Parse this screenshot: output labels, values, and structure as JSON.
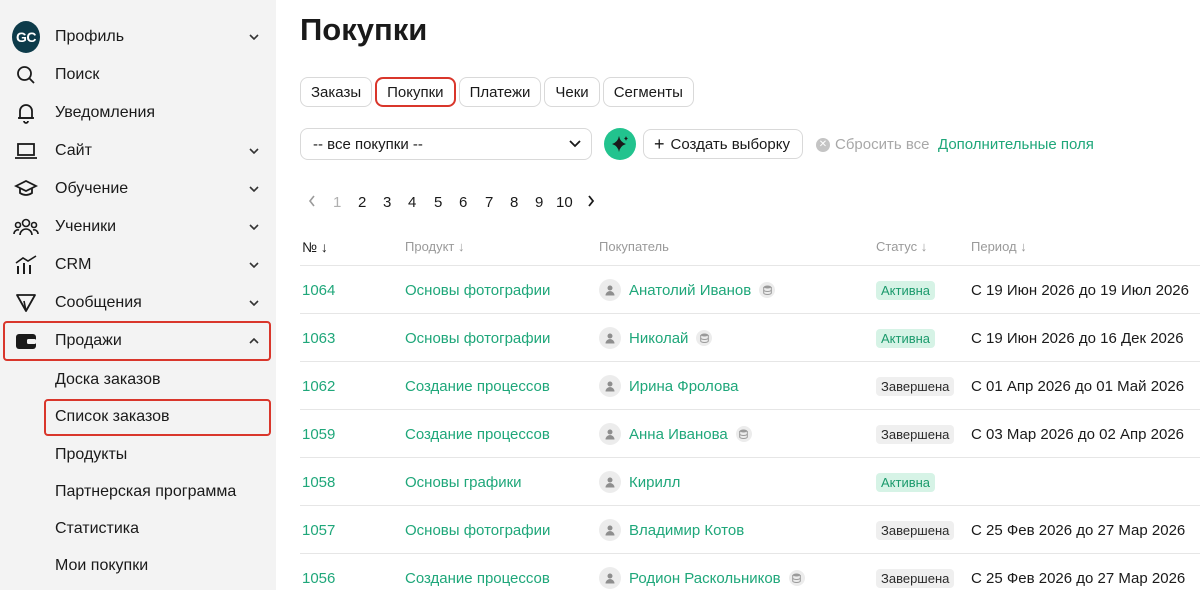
{
  "sidebar": {
    "logo_text": "GC",
    "items": [
      {
        "label": "Профиль",
        "icon": "logo",
        "chevron": "down"
      },
      {
        "label": "Поиск",
        "icon": "search-icon",
        "chevron": ""
      },
      {
        "label": "Уведомления",
        "icon": "bell-icon",
        "chevron": ""
      },
      {
        "label": "Сайт",
        "icon": "laptop-icon",
        "chevron": "down"
      },
      {
        "label": "Обучение",
        "icon": "graduation-cap-icon",
        "chevron": "down"
      },
      {
        "label": "Ученики",
        "icon": "users-icon",
        "chevron": "down"
      },
      {
        "label": "CRM",
        "icon": "chart-icon",
        "chevron": "down"
      },
      {
        "label": "Сообщения",
        "icon": "send-icon",
        "chevron": "down"
      },
      {
        "label": "Продажи",
        "icon": "wallet-icon",
        "chevron": "up"
      }
    ],
    "sub_items": [
      {
        "label": "Доска заказов"
      },
      {
        "label": "Список заказов"
      },
      {
        "label": "Продукты"
      },
      {
        "label": "Партнерская программа"
      },
      {
        "label": "Статистика"
      },
      {
        "label": "Мои покупки"
      }
    ]
  },
  "main": {
    "title": "Покупки",
    "tabs": [
      {
        "label": "Заказы"
      },
      {
        "label": "Покупки"
      },
      {
        "label": "Платежи"
      },
      {
        "label": "Чеки"
      },
      {
        "label": "Сегменты"
      }
    ],
    "filter_select": "-- все покупки --",
    "create_button": "Создать выборку",
    "reset_label": "Сбросить все",
    "extra_fields": "Дополнительные поля",
    "pages": [
      "1",
      "2",
      "3",
      "4",
      "5",
      "6",
      "7",
      "8",
      "9",
      "10"
    ],
    "current_page": "1",
    "columns": {
      "num": "№",
      "product": "Продукт",
      "buyer": "Покупатель",
      "status": "Статус",
      "period": "Период"
    },
    "rows": [
      {
        "id": "1064",
        "product": "Основы фотографии",
        "buyer": "Анатолий Иванов",
        "db": true,
        "status": "Активна",
        "status_type": "active",
        "period": "С 19 Июн 2026 до 19 Июл 2026"
      },
      {
        "id": "1063",
        "product": "Основы фотографии",
        "buyer": "Николай",
        "db": true,
        "status": "Активна",
        "status_type": "active",
        "period": "С 19 Июн 2026 до 16 Дек 2026"
      },
      {
        "id": "1062",
        "product": "Создание процессов",
        "buyer": "Ирина Фролова",
        "db": false,
        "status": "Завершена",
        "status_type": "done",
        "period": "С 01 Апр 2026 до 01 Май 2026"
      },
      {
        "id": "1059",
        "product": "Создание процессов",
        "buyer": "Анна Иванова",
        "db": true,
        "status": "Завершена",
        "status_type": "done",
        "period": "С 03 Мар 2026 до 02 Апр 2026"
      },
      {
        "id": "1058",
        "product": "Основы графики",
        "buyer": "Кирилл",
        "db": false,
        "status": "Активна",
        "status_type": "active",
        "period": ""
      },
      {
        "id": "1057",
        "product": "Основы фотографии",
        "buyer": "Владимир Котов",
        "db": false,
        "status": "Завершена",
        "status_type": "done",
        "period": "С 25 Фев 2026 до 27 Мар 2026"
      },
      {
        "id": "1056",
        "product": "Создание процессов",
        "buyer": "Родион Раскольников",
        "db": true,
        "status": "Завершена",
        "status_type": "done",
        "period": "С 25 Фев 2026 до 27 Мар 2026"
      }
    ]
  },
  "colors": {
    "accent": "#1fa77a",
    "highlight": "#d9362b",
    "sidebar_bg": "#f3f3f3"
  }
}
